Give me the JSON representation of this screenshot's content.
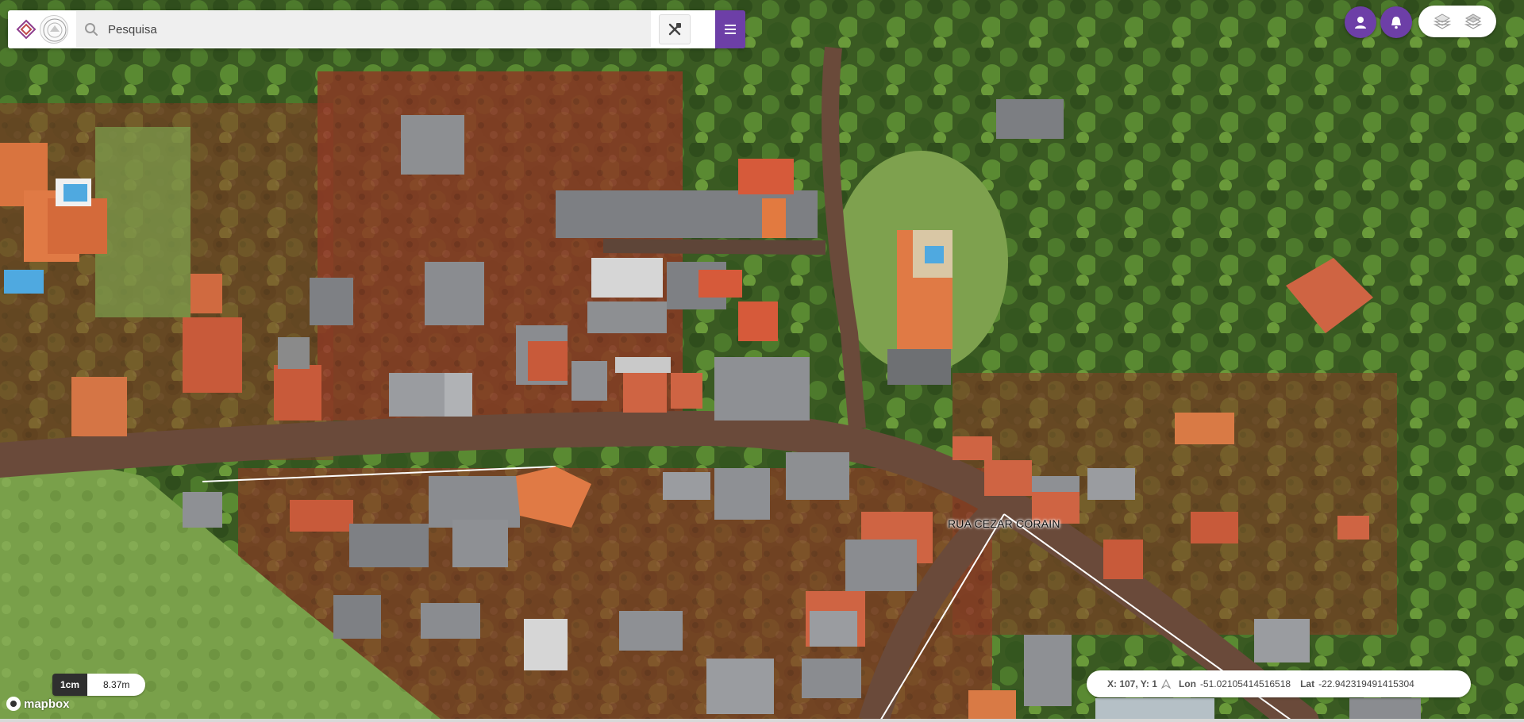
{
  "search": {
    "placeholder": "Pesquisa"
  },
  "map": {
    "street_label": "RUA CEZAR CORAIN"
  },
  "scale": {
    "unit": "1cm",
    "distance": "8.37m"
  },
  "attribution": {
    "text": "mapbox"
  },
  "coordinates": {
    "xy_label": "X: 107, Y: 1",
    "lon_label": "Lon",
    "lon_value": "-51.02105414516518",
    "lat_label": "Lat",
    "lat_value": "-22.942319491415304"
  },
  "colors": {
    "accent": "#6d3fa7",
    "panel": "#ffffff"
  },
  "icons": {
    "user": "user-icon",
    "notifications": "bell-icon",
    "layers_a": "layers-icon",
    "layers_b": "layers-stack-icon",
    "search": "search-icon",
    "tools": "tools-icon",
    "menu": "menu-icon"
  }
}
